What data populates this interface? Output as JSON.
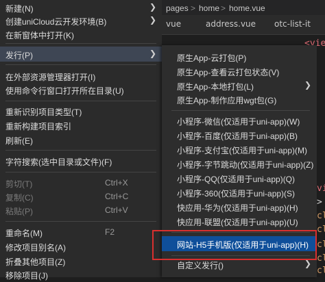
{
  "editor": {
    "breadcrumb": [
      "pages",
      "home",
      "home.vue"
    ],
    "breadcrumb_sep": ">",
    "tabs": [
      "vue",
      "address.vue",
      "otc-list-it"
    ],
    "code_fragments": [
      "<vie",
      "vi",
      ">",
      "cl",
      "cl",
      "cl",
      "cl",
      "cl",
      "<",
      "<"
    ]
  },
  "main_menu": {
    "items": [
      {
        "label": "新建(N)",
        "arrow": "❯"
      },
      {
        "label": "创建uniCloud云开发环境(B)",
        "arrow": "❯"
      },
      {
        "label": "在新窗体中打开(K)"
      },
      {
        "label": "发行(P)",
        "arrow": "❯"
      },
      {
        "label": "在外部资源管理器打开(I)"
      },
      {
        "label": "使用命令行窗口打开所在目录(U)"
      },
      {
        "label": "重新识别项目类型(T)"
      },
      {
        "label": "重新构建项目索引"
      },
      {
        "label": "刷新(E)"
      },
      {
        "label": "字符搜索(选中目录或文件)(F)"
      },
      {
        "label": "剪切(T)",
        "shortcut": "Ctrl+X"
      },
      {
        "label": "复制(C)",
        "shortcut": "Ctrl+C"
      },
      {
        "label": "粘贴(P)",
        "shortcut": "Ctrl+V"
      },
      {
        "label": "重命名(M)",
        "shortcut": "F2"
      },
      {
        "label": "修改项目别名(A)"
      },
      {
        "label": "折叠其他项目(Z)"
      },
      {
        "label": "移除项目(J)"
      }
    ]
  },
  "sub_menu": {
    "items": [
      {
        "label": "原生App-云打包(P)"
      },
      {
        "label": "原生App-查看云打包状态(V)"
      },
      {
        "label": "原生App-本地打包(L)",
        "arrow": "❯"
      },
      {
        "label": "原生App-制作应用wgt包(G)"
      },
      {
        "label": "小程序-微信(仅适用于uni-app)(W)"
      },
      {
        "label": "小程序-百度(仅适用于uni-app)(B)"
      },
      {
        "label": "小程序-支付宝(仅适用于uni-app)(M)"
      },
      {
        "label": "小程序-字节跳动(仅适用于uni-app)(Z)"
      },
      {
        "label": "小程序-QQ(仅适用于uni-app)(Q)"
      },
      {
        "label": "小程序-360(仅适用于uni-app)(S)"
      },
      {
        "label": "快应用-华为(仅适用于uni-app)(H)"
      },
      {
        "label": "快应用-联盟(仅适用于uni-app)(U)"
      },
      {
        "label": "网站-H5手机版(仅适用于uni-app)(H)"
      },
      {
        "label": "自定义发行()",
        "arrow": "❯"
      }
    ]
  },
  "colors": {
    "menu_bg": "#2b2b2b",
    "highlight": "#0f4f9a",
    "annotation_box": "#d9302f",
    "disabled_text": "#7b7b7b"
  }
}
